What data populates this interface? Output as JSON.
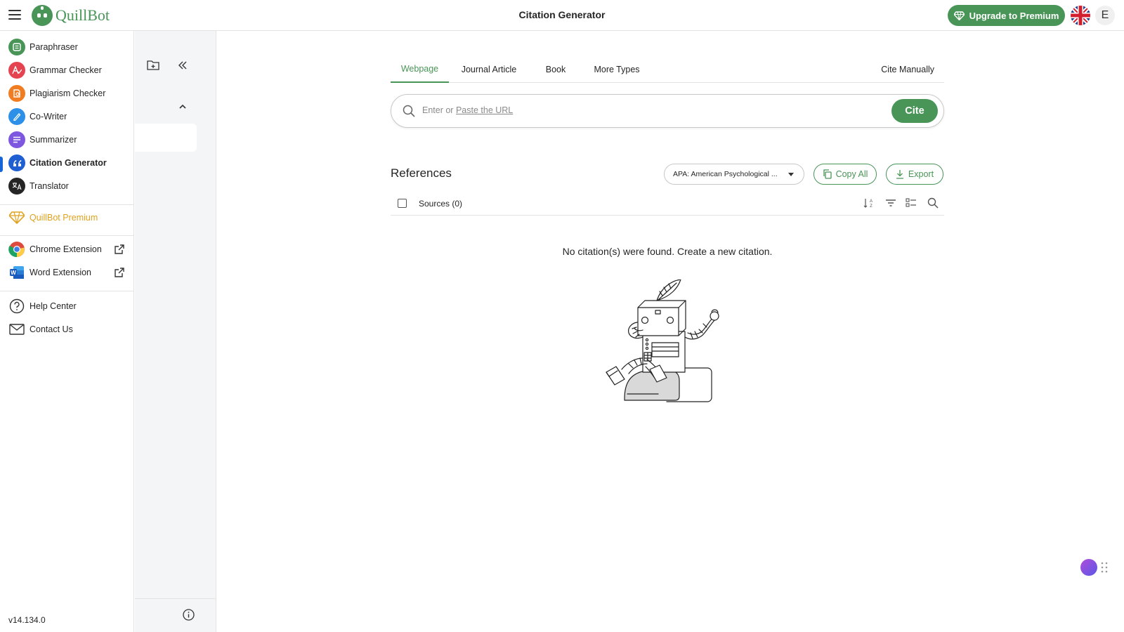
{
  "app": {
    "logo_text": "QuillBot",
    "page_title": "Citation Generator",
    "upgrade_label": "Upgrade to Premium",
    "user_initial": "E",
    "version": "v14.134.0"
  },
  "nav": {
    "tools": [
      {
        "label": "Paraphraser",
        "icon": "paraphraser-icon",
        "color": "#499557"
      },
      {
        "label": "Grammar Checker",
        "icon": "grammar-checker-icon",
        "color": "#e5434f"
      },
      {
        "label": "Plagiarism Checker",
        "icon": "plagiarism-checker-icon",
        "color": "#f07d22"
      },
      {
        "label": "Co-Writer",
        "icon": "co-writer-icon",
        "color": "#2c8fe8"
      },
      {
        "label": "Summarizer",
        "icon": "summarizer-icon",
        "color": "#7e57e0"
      },
      {
        "label": "Citation Generator",
        "icon": "citation-generator-icon",
        "color": "#1f5fd1",
        "active": true
      },
      {
        "label": "Translator",
        "icon": "translator-icon",
        "color": "#252525"
      }
    ],
    "premium_label": "QuillBot Premium",
    "extensions": [
      {
        "label": "Chrome Extension",
        "icon": "chrome-icon"
      },
      {
        "label": "Word Extension",
        "icon": "word-icon"
      }
    ],
    "support": [
      {
        "label": "Help Center",
        "icon": "help-icon"
      },
      {
        "label": "Contact Us",
        "icon": "mail-icon"
      }
    ]
  },
  "tabs": {
    "items": [
      "Webpage",
      "Journal Article",
      "Book",
      "More Types"
    ],
    "active": "Webpage",
    "cite_manually": "Cite Manually"
  },
  "search": {
    "placeholder_prefix": "Enter or",
    "placeholder_link": "Paste the URL",
    "cite_label": "Cite"
  },
  "references": {
    "title": "References",
    "style_value": "APA: American Psychological ...",
    "copy_all_label": "Copy All",
    "export_label": "Export",
    "sources_label": "Sources (0)",
    "empty_message": "No citation(s) were found. Create a new citation."
  },
  "colors": {
    "brand_green": "#499557",
    "active_blue": "#1565d8",
    "premium_gold": "#e0a21f"
  }
}
